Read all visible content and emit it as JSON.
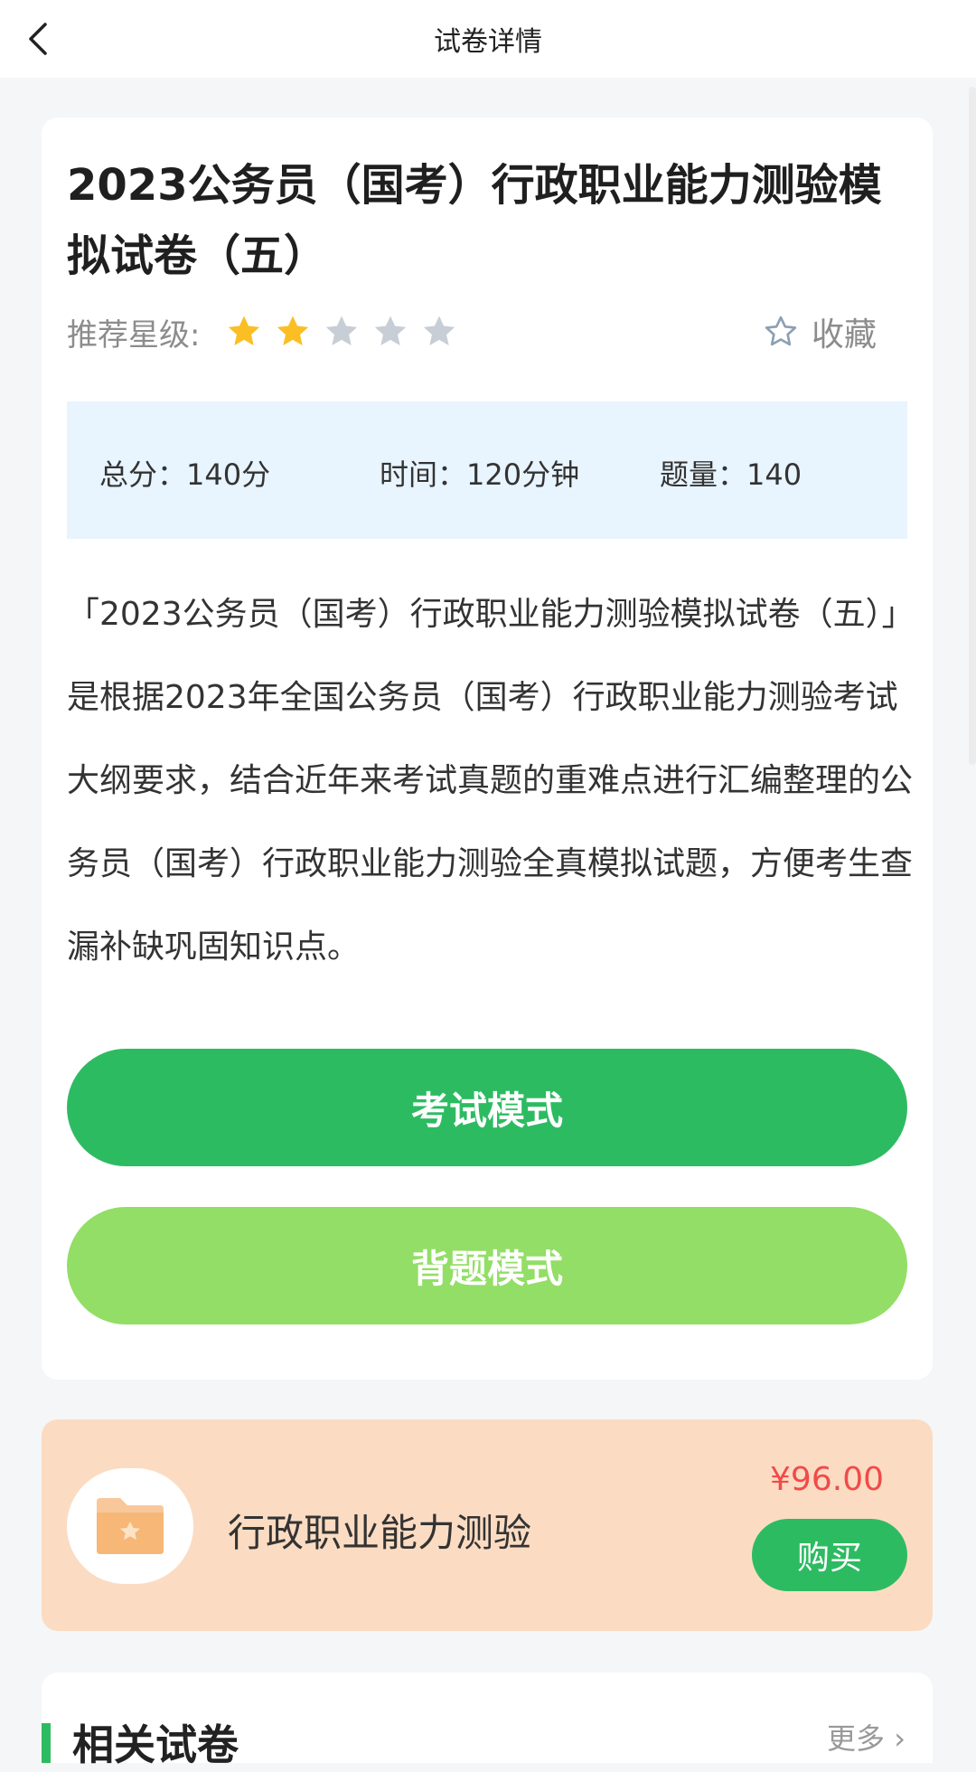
{
  "header": {
    "title": "试卷详情"
  },
  "paper": {
    "title": "2023公务员（国考）行政职业能力测验模拟试卷（五）",
    "rating_label": "推荐星级:",
    "rating": 2,
    "rating_max": 5,
    "favorite_label": "收藏",
    "stats": {
      "total_score": "总分：140分",
      "time": "时间：120分钟",
      "question_count": "题量：140"
    },
    "description": "「2023公务员（国考）行政职业能力测验模拟试卷（五）」是根据2023年全国公务员（国考）行政职业能力测验考试大纲要求，结合近年来考试真题的重难点进行汇编整理的公务员（国考）行政职业能力测验全真模拟试题，方便考生查漏补缺巩固知识点。"
  },
  "buttons": {
    "exam_mode": "考试模式",
    "study_mode": "背题模式"
  },
  "course": {
    "name": "行政职业能力测验",
    "price": "¥96.00",
    "buy_label": "购买"
  },
  "related": {
    "title": "相关试卷",
    "more_label": "更多 ›"
  },
  "colors": {
    "primary_green": "#2dbb62",
    "light_green": "#93de66",
    "star_active": "#fbbf24",
    "star_inactive": "#c8ced6",
    "price_red": "#f24a4a",
    "course_bg": "#fbdcc2",
    "stats_bg": "#e8f4fe"
  }
}
